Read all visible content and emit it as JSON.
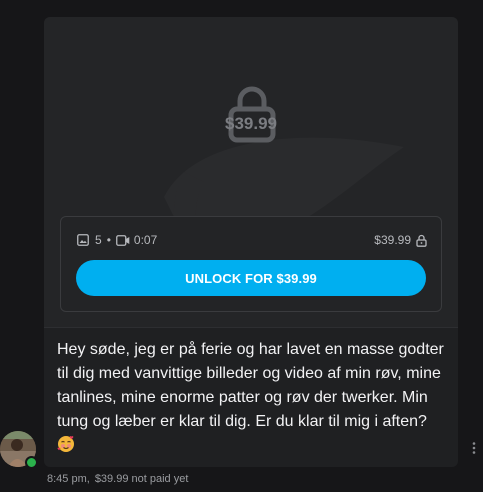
{
  "post": {
    "locked_price": "$39.99",
    "media_counts": {
      "images": "5",
      "separator": "•",
      "video_duration": "0:07"
    },
    "box_price": "$39.99",
    "unlock_label": "UNLOCK FOR $39.99",
    "message_lines": [
      "Hey søde, jeg er på ferie og har lavet en masse godter",
      "til dig med vanvittige billeder og video af min røv, mine",
      "tanlines, mine enorme patter og røv der twerker. Min",
      "tung og læber er klar til dig. Er du klar til mig i aften?"
    ],
    "emoji": "🥰",
    "time": "8:45 pm,",
    "status": "$39.99 not paid yet"
  },
  "icons": {
    "lock": "lock-icon",
    "image": "image-icon",
    "video": "video-icon",
    "more": "more-vertical-icon"
  },
  "colors": {
    "accent": "#00aff0",
    "online": "#2bb24c"
  }
}
